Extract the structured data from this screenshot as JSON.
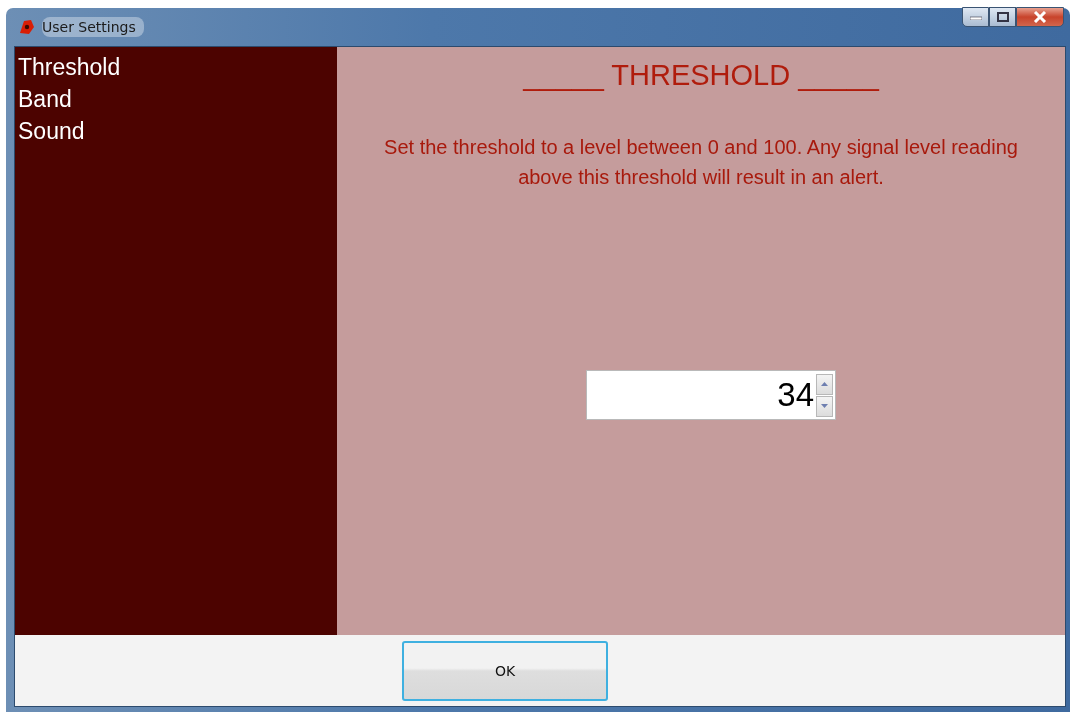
{
  "window": {
    "title": "User Settings"
  },
  "sidebar": {
    "items": [
      {
        "label": "Threshold"
      },
      {
        "label": "Band"
      },
      {
        "label": "Sound"
      }
    ]
  },
  "panel": {
    "heading": "_____ THRESHOLD _____",
    "description": "Set the threshold to a level between 0 and 100. Any signal level reading above this threshold will result in an alert.",
    "threshold": {
      "value": "34"
    }
  },
  "buttons": [
    "OK"
  ]
}
